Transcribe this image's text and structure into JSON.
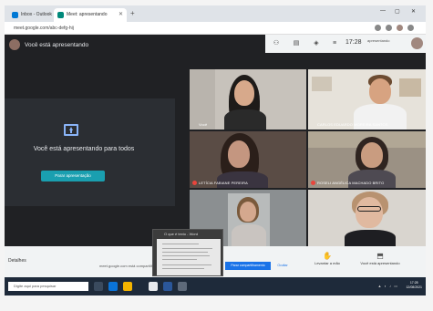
{
  "browser": {
    "tabs": [
      {
        "label": "Inbox - Outlook"
      },
      {
        "label": "Meet: apresentando"
      }
    ],
    "url": "meet.google.com/abc-defg-hij"
  },
  "meet": {
    "presenting_label": "Você está apresentando",
    "present_message": "Você está apresentando para todos",
    "stop_button": "Parar apresentação",
    "clock": "17:28",
    "self_name": "apresentando"
  },
  "participants": [
    {
      "name": "Você"
    },
    {
      "name": "CARLOS EDUARDO MOREIRA SANTOS"
    },
    {
      "name": "LETÍCIA FABIANE PEREIRA"
    },
    {
      "name": "ROSELI ANGÉLICA MACHADO BRITO"
    },
    {
      "name": ""
    },
    {
      "name": ""
    }
  ],
  "meetbar": {
    "left": "Detalhes",
    "raise_hand": "Levantar a mão",
    "stop_presenting": "Você está apresentando"
  },
  "thumbnail": {
    "title": "O que é texto - Word"
  },
  "notification": {
    "text": "meet.google.com está compartilhando sua tela",
    "btn_stop": "Parar compartilhamento",
    "btn_hide": "Ocultar"
  },
  "taskbar": {
    "search": "Digite aqui para pesquisar",
    "time": "17:28",
    "date": "12/08/2021"
  }
}
